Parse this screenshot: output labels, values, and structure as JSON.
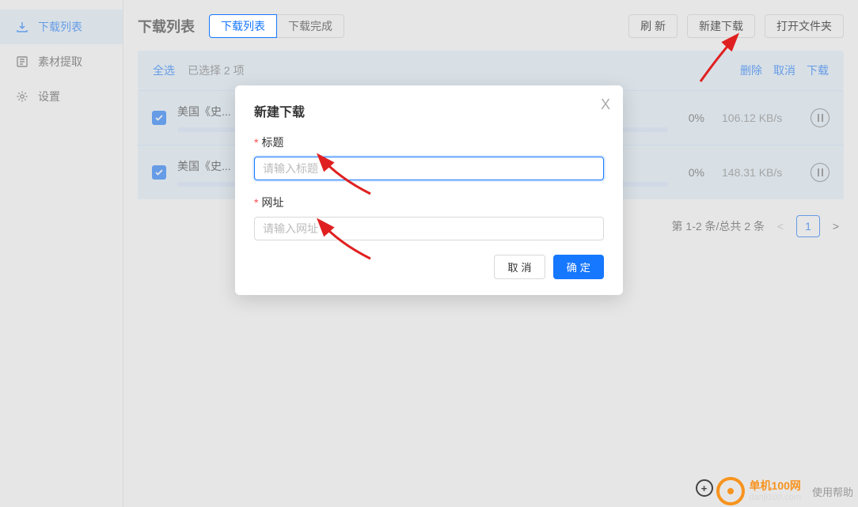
{
  "sidebar": {
    "items": [
      {
        "label": "下载列表",
        "icon": "download-icon"
      },
      {
        "label": "素材提取",
        "icon": "extract-icon"
      },
      {
        "label": "设置",
        "icon": "gear-icon"
      }
    ]
  },
  "header": {
    "title": "下载列表",
    "tabs": [
      {
        "label": "下载列表"
      },
      {
        "label": "下载完成"
      }
    ],
    "buttons": {
      "refresh": "刷 新",
      "new_download": "新建下载",
      "open_folder": "打开文件夹"
    }
  },
  "selection": {
    "select_all": "全选",
    "count_text": "已选择 2 项",
    "actions": {
      "delete": "删除",
      "cancel": "取消",
      "download": "下载"
    }
  },
  "items": [
    {
      "title": "美国《史...",
      "percent": "0%",
      "speed": "106.12 KB/s",
      "checked": true
    },
    {
      "title": "美国《史...",
      "percent": "0%",
      "speed": "148.31 KB/s",
      "checked": true
    }
  ],
  "pagination": {
    "text": "第 1-2 条/总共 2 条",
    "current": "1"
  },
  "modal": {
    "title": "新建下载",
    "close_glyph": "X",
    "title_label": "标题",
    "title_placeholder": "请输入标题",
    "url_label": "网址",
    "url_placeholder": "请输入网址",
    "cancel": "取 消",
    "confirm": "确 定"
  },
  "watermark": {
    "line1": "单机100网",
    "line2": "danji100.com",
    "help": "使用帮助"
  }
}
